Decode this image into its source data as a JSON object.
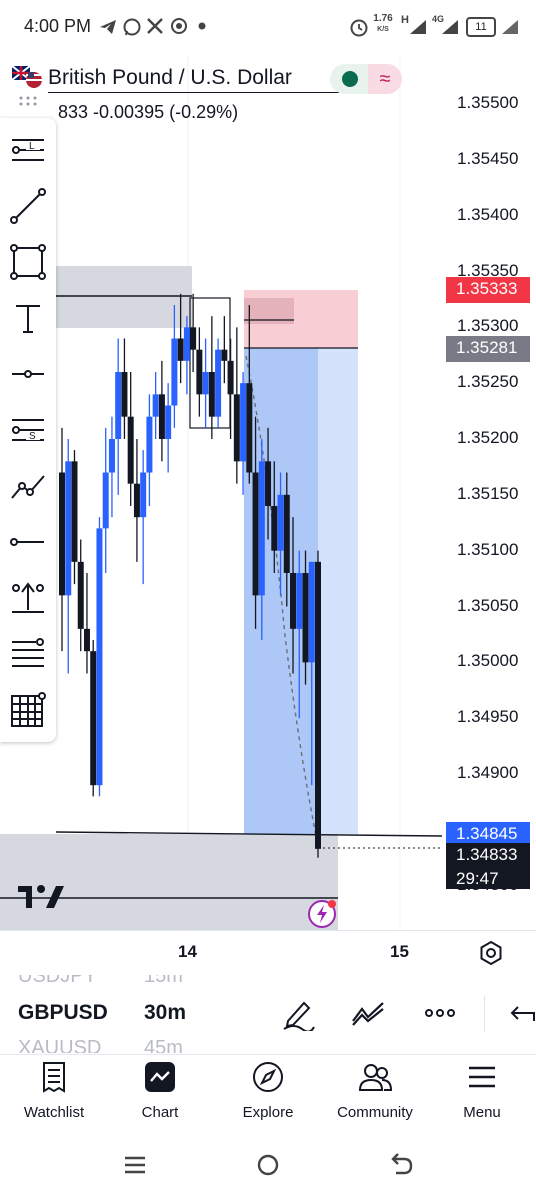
{
  "status_bar": {
    "time": "4:00 PM",
    "data_rate": "1.76",
    "data_rate_unit": "K/S",
    "network_h": "H",
    "network_4g": "4G",
    "battery": "11",
    "icons": [
      "telegram-icon",
      "whatsapp-icon",
      "x-icon",
      "chrome-icon",
      "dot-icon",
      "alarm-icon",
      "signal-icon",
      "battery-icon"
    ]
  },
  "header": {
    "symbol_name": "British Pound / U.S. Dollar",
    "price_change": "833  -0.00395 (-0.29%)",
    "status_color": "#0b6b4f",
    "wave_symbol": "≈"
  },
  "price_axis": {
    "ticks": [
      "1.35500",
      "1.35450",
      "1.35400",
      "1.35350",
      "1.35300",
      "1.35250",
      "1.35200",
      "1.35150",
      "1.35100",
      "1.35050",
      "1.35000",
      "1.34950",
      "1.34900",
      "1.34800"
    ],
    "badges": [
      {
        "value": "1.35333",
        "color": "#f23645"
      },
      {
        "value": "1.35281",
        "color": "#787b86"
      },
      {
        "value": "1.34845",
        "color": "#2962ff"
      },
      {
        "value": "1.34833",
        "color": "#131722"
      }
    ],
    "countdown": "29:47"
  },
  "time_axis": {
    "labels": [
      "14",
      "15"
    ]
  },
  "chart_data": {
    "type": "candlestick",
    "symbol": "GBPUSD",
    "interval": "30m",
    "ylim": [
      1.3478,
      1.3552
    ],
    "last_price": 1.34833,
    "candles": [
      {
        "o": 1.3517,
        "h": 1.3521,
        "l": 1.3501,
        "c": 1.3506
      },
      {
        "o": 1.3506,
        "h": 1.352,
        "l": 1.3499,
        "c": 1.3518
      },
      {
        "o": 1.3518,
        "h": 1.3519,
        "l": 1.3507,
        "c": 1.3509
      },
      {
        "o": 1.3509,
        "h": 1.3511,
        "l": 1.3501,
        "c": 1.3503
      },
      {
        "o": 1.3503,
        "h": 1.3508,
        "l": 1.3499,
        "c": 1.3501
      },
      {
        "o": 1.3501,
        "h": 1.3502,
        "l": 1.3488,
        "c": 1.3489
      },
      {
        "o": 1.3489,
        "h": 1.3513,
        "l": 1.3488,
        "c": 1.3512
      },
      {
        "o": 1.3512,
        "h": 1.3521,
        "l": 1.3508,
        "c": 1.3517
      },
      {
        "o": 1.3517,
        "h": 1.3522,
        "l": 1.3513,
        "c": 1.352
      },
      {
        "o": 1.352,
        "h": 1.3529,
        "l": 1.3515,
        "c": 1.3526
      },
      {
        "o": 1.3526,
        "h": 1.3529,
        "l": 1.352,
        "c": 1.3522
      },
      {
        "o": 1.3522,
        "h": 1.3526,
        "l": 1.3514,
        "c": 1.3516
      },
      {
        "o": 1.3516,
        "h": 1.352,
        "l": 1.3509,
        "c": 1.3513
      },
      {
        "o": 1.3513,
        "h": 1.3519,
        "l": 1.3507,
        "c": 1.3517
      },
      {
        "o": 1.3517,
        "h": 1.3524,
        "l": 1.3514,
        "c": 1.3522
      },
      {
        "o": 1.3522,
        "h": 1.3526,
        "l": 1.352,
        "c": 1.3524
      },
      {
        "o": 1.3524,
        "h": 1.3527,
        "l": 1.3518,
        "c": 1.352
      },
      {
        "o": 1.352,
        "h": 1.3525,
        "l": 1.3517,
        "c": 1.3523
      },
      {
        "o": 1.3523,
        "h": 1.3532,
        "l": 1.3521,
        "c": 1.3529
      },
      {
        "o": 1.3529,
        "h": 1.3533,
        "l": 1.3525,
        "c": 1.3527
      },
      {
        "o": 1.3527,
        "h": 1.3531,
        "l": 1.3524,
        "c": 1.353
      },
      {
        "o": 1.353,
        "h": 1.3533,
        "l": 1.3526,
        "c": 1.3528
      },
      {
        "o": 1.3528,
        "h": 1.353,
        "l": 1.3522,
        "c": 1.3524
      },
      {
        "o": 1.3524,
        "h": 1.3529,
        "l": 1.3521,
        "c": 1.3526
      },
      {
        "o": 1.3526,
        "h": 1.3531,
        "l": 1.352,
        "c": 1.3522
      },
      {
        "o": 1.3522,
        "h": 1.3529,
        "l": 1.3521,
        "c": 1.3528
      },
      {
        "o": 1.3528,
        "h": 1.3531,
        "l": 1.3525,
        "c": 1.3527
      },
      {
        "o": 1.3527,
        "h": 1.3529,
        "l": 1.352,
        "c": 1.3524
      },
      {
        "o": 1.3524,
        "h": 1.353,
        "l": 1.3516,
        "c": 1.3518
      },
      {
        "o": 1.3518,
        "h": 1.3526,
        "l": 1.3515,
        "c": 1.3525
      },
      {
        "o": 1.3525,
        "h": 1.3532,
        "l": 1.3516,
        "c": 1.3517
      },
      {
        "o": 1.3517,
        "h": 1.3522,
        "l": 1.3503,
        "c": 1.3506
      },
      {
        "o": 1.3506,
        "h": 1.352,
        "l": 1.3502,
        "c": 1.3518
      },
      {
        "o": 1.3518,
        "h": 1.3521,
        "l": 1.3511,
        "c": 1.3514
      },
      {
        "o": 1.3514,
        "h": 1.3518,
        "l": 1.3508,
        "c": 1.351
      },
      {
        "o": 1.351,
        "h": 1.3517,
        "l": 1.3506,
        "c": 1.3515
      },
      {
        "o": 1.3515,
        "h": 1.3517,
        "l": 1.3505,
        "c": 1.3508
      },
      {
        "o": 1.3508,
        "h": 1.3513,
        "l": 1.3499,
        "c": 1.3503
      },
      {
        "o": 1.3503,
        "h": 1.351,
        "l": 1.3495,
        "c": 1.3508
      },
      {
        "o": 1.3508,
        "h": 1.351,
        "l": 1.3498,
        "c": 1.35
      },
      {
        "o": 1.35,
        "h": 1.3509,
        "l": 1.3489,
        "c": 1.3509
      },
      {
        "o": 1.3509,
        "h": 1.351,
        "l": 1.34825,
        "c": 1.34833
      }
    ]
  },
  "drawing_tools": [
    {
      "name": "horizontal-lines-L-icon"
    },
    {
      "name": "trend-line-icon"
    },
    {
      "name": "rectangle-icon"
    },
    {
      "name": "text-tool-icon"
    },
    {
      "name": "horizontal-ray-icon"
    },
    {
      "name": "horizontal-lines-S-icon"
    },
    {
      "name": "polyline-icon"
    },
    {
      "name": "ray-icon"
    },
    {
      "name": "arrow-marker-icon"
    },
    {
      "name": "parallel-channel-icon"
    },
    {
      "name": "grid-icon"
    }
  ],
  "symbol_bar": {
    "prev_symbol": "USDJPY",
    "prev_interval": "15m",
    "symbol": "GBPUSD",
    "interval": "30m",
    "next_symbol": "XAUUSD",
    "next_interval": "45m"
  },
  "bottom_nav": [
    {
      "label": "Watchlist",
      "icon": "watchlist-icon"
    },
    {
      "label": "Chart",
      "icon": "chart-icon"
    },
    {
      "label": "Explore",
      "icon": "compass-icon"
    },
    {
      "label": "Community",
      "icon": "community-icon"
    },
    {
      "label": "Menu",
      "icon": "menu-icon"
    }
  ],
  "tv_logo": "TradingView"
}
